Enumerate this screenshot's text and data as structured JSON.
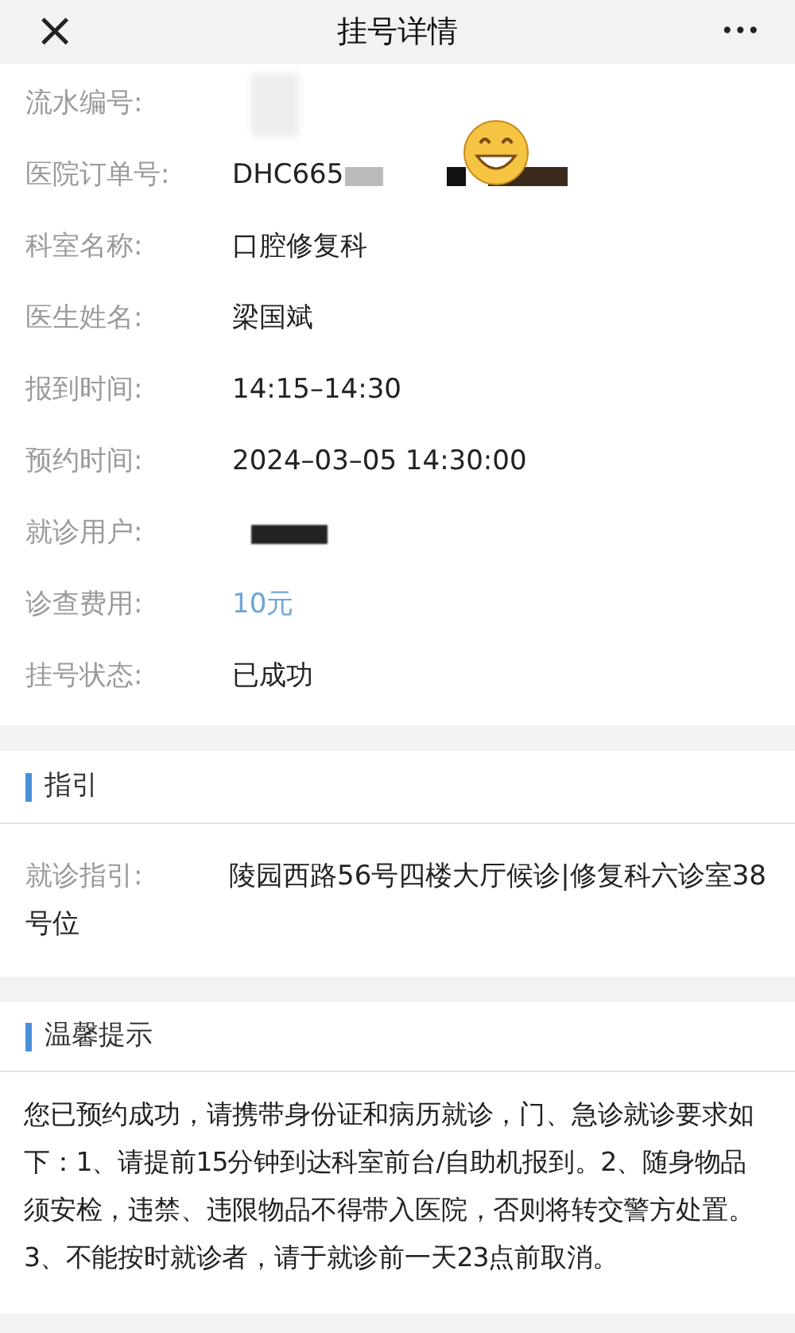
{
  "header": {
    "close": "×",
    "title": "挂号详情",
    "more": "•••"
  },
  "details": [
    {
      "label": "流水编号:",
      "kind": "redacted"
    },
    {
      "label": "医院订单号:",
      "kind": "partial",
      "value": "DHC665"
    },
    {
      "label": "科室名称:",
      "kind": "plain",
      "value": "口腔修复科"
    },
    {
      "label": "医生姓名:",
      "kind": "plain",
      "value": "梁国斌"
    },
    {
      "label": "报到时间:",
      "kind": "plain",
      "value": "14:15–14:30"
    },
    {
      "label": "预约时间:",
      "kind": "plain",
      "value": "2024–03–05 14:30:00"
    },
    {
      "label": "就诊用户:",
      "kind": "redacted"
    },
    {
      "label": "诊查费用:",
      "kind": "fee",
      "value": "10元"
    },
    {
      "label": "挂号状态:",
      "kind": "plain",
      "value": "已成功"
    }
  ],
  "guide": {
    "heading": "指引",
    "label": "就诊指引:",
    "value": "陵园西路56号四楼大厅候诊|修复科六诊室38号位"
  },
  "tips": {
    "heading": "温馨提示",
    "text": "您已预约成功，请携带身份证和病历就诊，门、急诊就诊要求如下：1、请提前15分钟到达科室前台/自助机报到。2、随身物品须安检，违禁、违限物品不得带入医院，否则将转交警方处置。3、不能按时就诊者，请于就诊前一天23点前取消。"
  }
}
